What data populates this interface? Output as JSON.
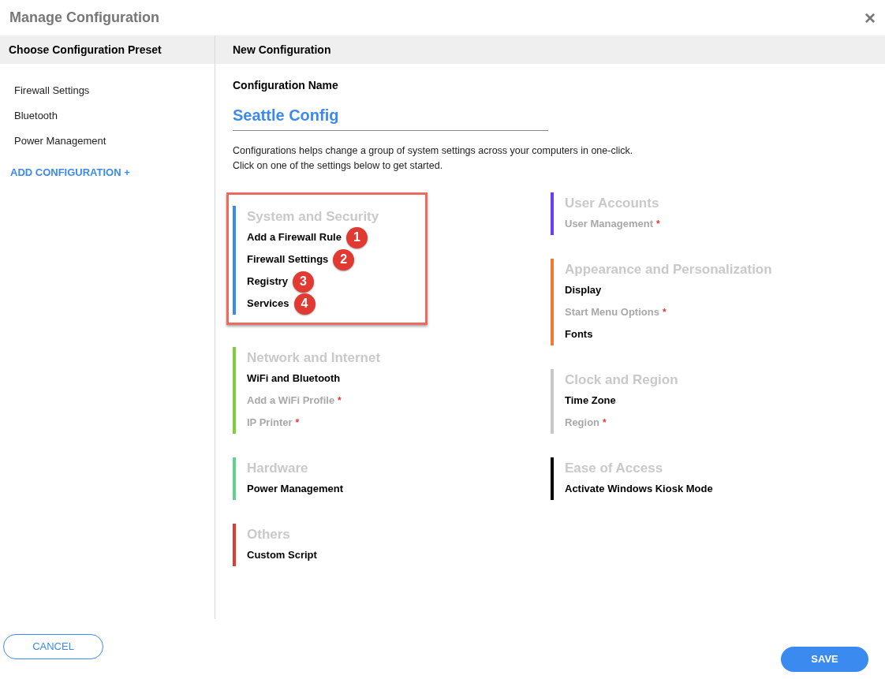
{
  "window": {
    "title": "Manage Configuration",
    "close": "×"
  },
  "sidebar": {
    "header": "Choose Configuration Preset",
    "items": [
      {
        "label": "Firewall Settings"
      },
      {
        "label": "Bluetooth"
      },
      {
        "label": "Power Management"
      }
    ],
    "add_link": "ADD CONFIGURATION +"
  },
  "main": {
    "header": "New Configuration",
    "name_label": "Configuration Name",
    "name_value": "Seattle Config",
    "description": [
      "Configurations helps change a group of system settings across your computers in one-click.",
      "Click on one of the settings below to get started."
    ],
    "columns": [
      [
        {
          "title": "System and Security",
          "color": "#3b8af0",
          "highlighted": true,
          "items": [
            {
              "label": "Add a Firewall Rule",
              "disabled": false,
              "badge": "1"
            },
            {
              "label": "Firewall Settings",
              "disabled": false,
              "badge": "2"
            },
            {
              "label": "Registry",
              "disabled": false,
              "badge": "3"
            },
            {
              "label": "Services",
              "disabled": false,
              "badge": "4"
            }
          ]
        },
        {
          "title": "Network and Internet",
          "color": "#7ed03a",
          "highlighted": false,
          "items": [
            {
              "label": "WiFi and Bluetooth",
              "disabled": false
            },
            {
              "label": "Add a WiFi Profile",
              "disabled": true,
              "marker": "*"
            },
            {
              "label": "IP Printer",
              "disabled": true,
              "marker": "*"
            }
          ]
        },
        {
          "title": "Hardware",
          "color": "#5ed38e",
          "highlighted": false,
          "items": [
            {
              "label": "Power Management",
              "disabled": false
            }
          ]
        },
        {
          "title": "Others",
          "color": "#e53a2f",
          "highlighted": false,
          "items": [
            {
              "label": "Custom Script",
              "disabled": false
            }
          ]
        }
      ],
      [
        {
          "title": "User Accounts",
          "color": "#6a3cf5",
          "highlighted": false,
          "items": [
            {
              "label": "User Management",
              "disabled": true,
              "marker": "*"
            }
          ]
        },
        {
          "title": "Appearance and Personalization",
          "color": "#ee7a35",
          "highlighted": false,
          "items": [
            {
              "label": "Display",
              "disabled": false
            },
            {
              "label": "Start Menu Options",
              "disabled": true,
              "marker": "*"
            },
            {
              "label": "Fonts",
              "disabled": false
            }
          ]
        },
        {
          "title": "Clock and Region",
          "color": "#c8c8c8",
          "highlighted": false,
          "items": [
            {
              "label": "Time Zone",
              "disabled": false
            },
            {
              "label": "Region",
              "disabled": true,
              "marker": "*"
            }
          ]
        },
        {
          "title": "Ease of Access",
          "color": "#000000",
          "highlighted": false,
          "items": [
            {
              "label": "Activate Windows Kiosk Mode",
              "disabled": false
            }
          ]
        }
      ]
    ]
  },
  "buttons": {
    "cancel": "CANCEL",
    "save": "SAVE"
  }
}
